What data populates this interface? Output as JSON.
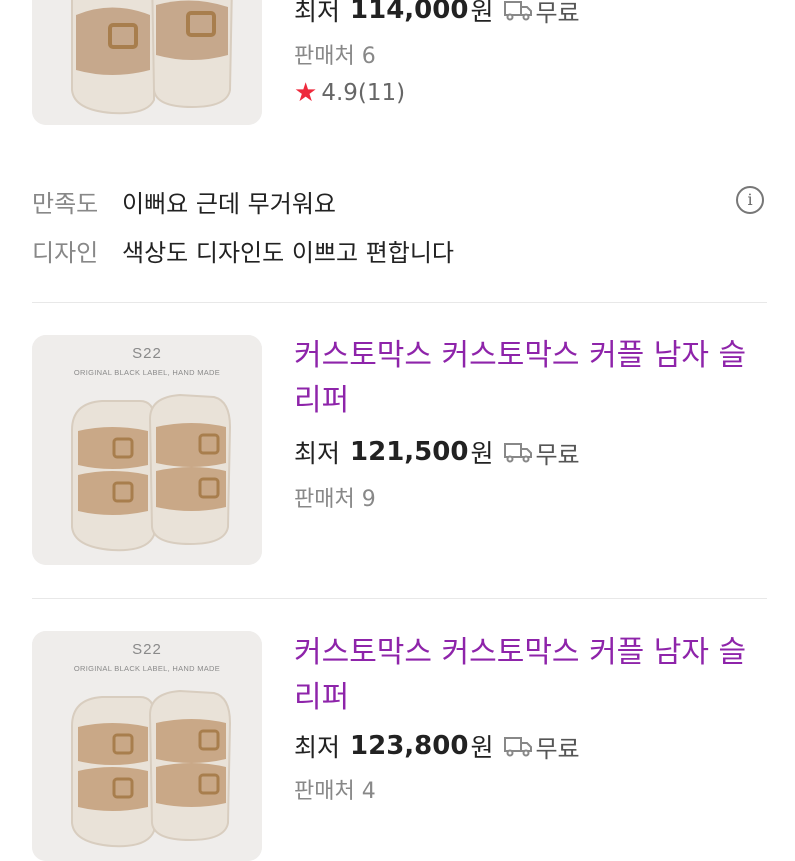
{
  "products": [
    {
      "image_code": "",
      "image_label": "",
      "title": "",
      "price_label": "최저",
      "price": "114,000",
      "price_unit": "원",
      "shipping": "무료",
      "sellers": "판매처 6",
      "rating": "4.9",
      "review_count": "(11)"
    },
    {
      "image_code": "S22",
      "image_label": "ORIGINAL BLACK LABEL, HAND MADE",
      "title": "커스토막스 커스토막스 커플 남자 슬리퍼",
      "price_label": "최저",
      "price": "121,500",
      "price_unit": "원",
      "shipping": "무료",
      "sellers": "판매처 9"
    },
    {
      "image_code": "S22",
      "image_label": "ORIGINAL BLACK LABEL, HAND MADE",
      "title": "커스토막스 커스토막스 커플 남자 슬리퍼",
      "price_label": "최저",
      "price": "123,800",
      "price_unit": "원",
      "shipping": "무료",
      "sellers": "판매처 4"
    }
  ],
  "review_summary": {
    "satisfaction_label": "만족도",
    "satisfaction_text": "이뻐요 근데 무거워요",
    "design_label": "디자인",
    "design_text": "색상도 디자인도 이쁘고 편합니다"
  },
  "icons": {
    "shipping": "truck-icon",
    "rating": "star-icon",
    "info": "info-icon"
  },
  "colors": {
    "title": "#8e24aa",
    "star": "#ee2a3c",
    "muted": "#888888"
  }
}
